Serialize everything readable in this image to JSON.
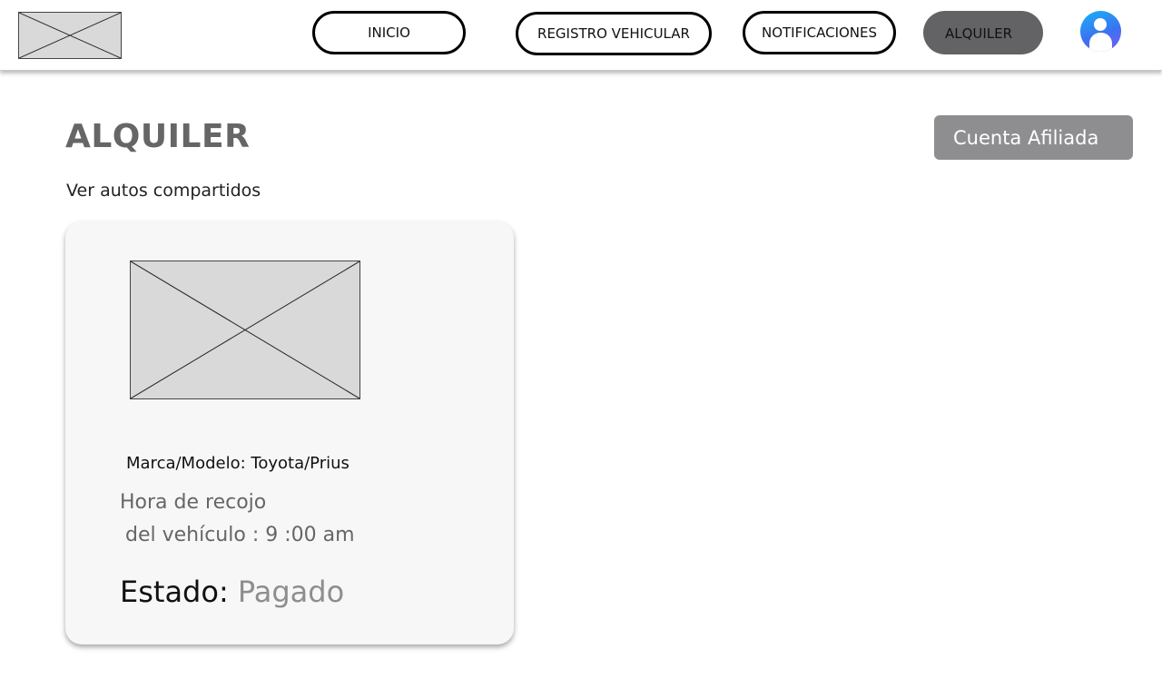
{
  "nav": {
    "items": [
      {
        "label": "INICIO"
      },
      {
        "label": "REGISTRO VEHICULAR"
      },
      {
        "label": "NOTIFICACIONES"
      },
      {
        "label": "ALQUILER",
        "active": true
      }
    ],
    "avatar_icon": "user-avatar-icon",
    "logo_icon": "image-placeholder-icon"
  },
  "page": {
    "title": "ALQUILER",
    "subtitle": "Ver autos compartidos",
    "account_button": "Cuenta Afiliada"
  },
  "card": {
    "image_icon": "image-placeholder-icon",
    "marca_modelo": "Marca/Modelo: Toyota/Prius",
    "hora_line1": "Hora de  recojo",
    "hora_line2": "del vehículo : 9 :00 am",
    "estado_label": "Estado: ",
    "estado_value": "Pagado"
  },
  "colors": {
    "active_nav": "#636366",
    "account_button": "#8e8d90",
    "status_value": "#8e8d90",
    "title": "#666666"
  }
}
